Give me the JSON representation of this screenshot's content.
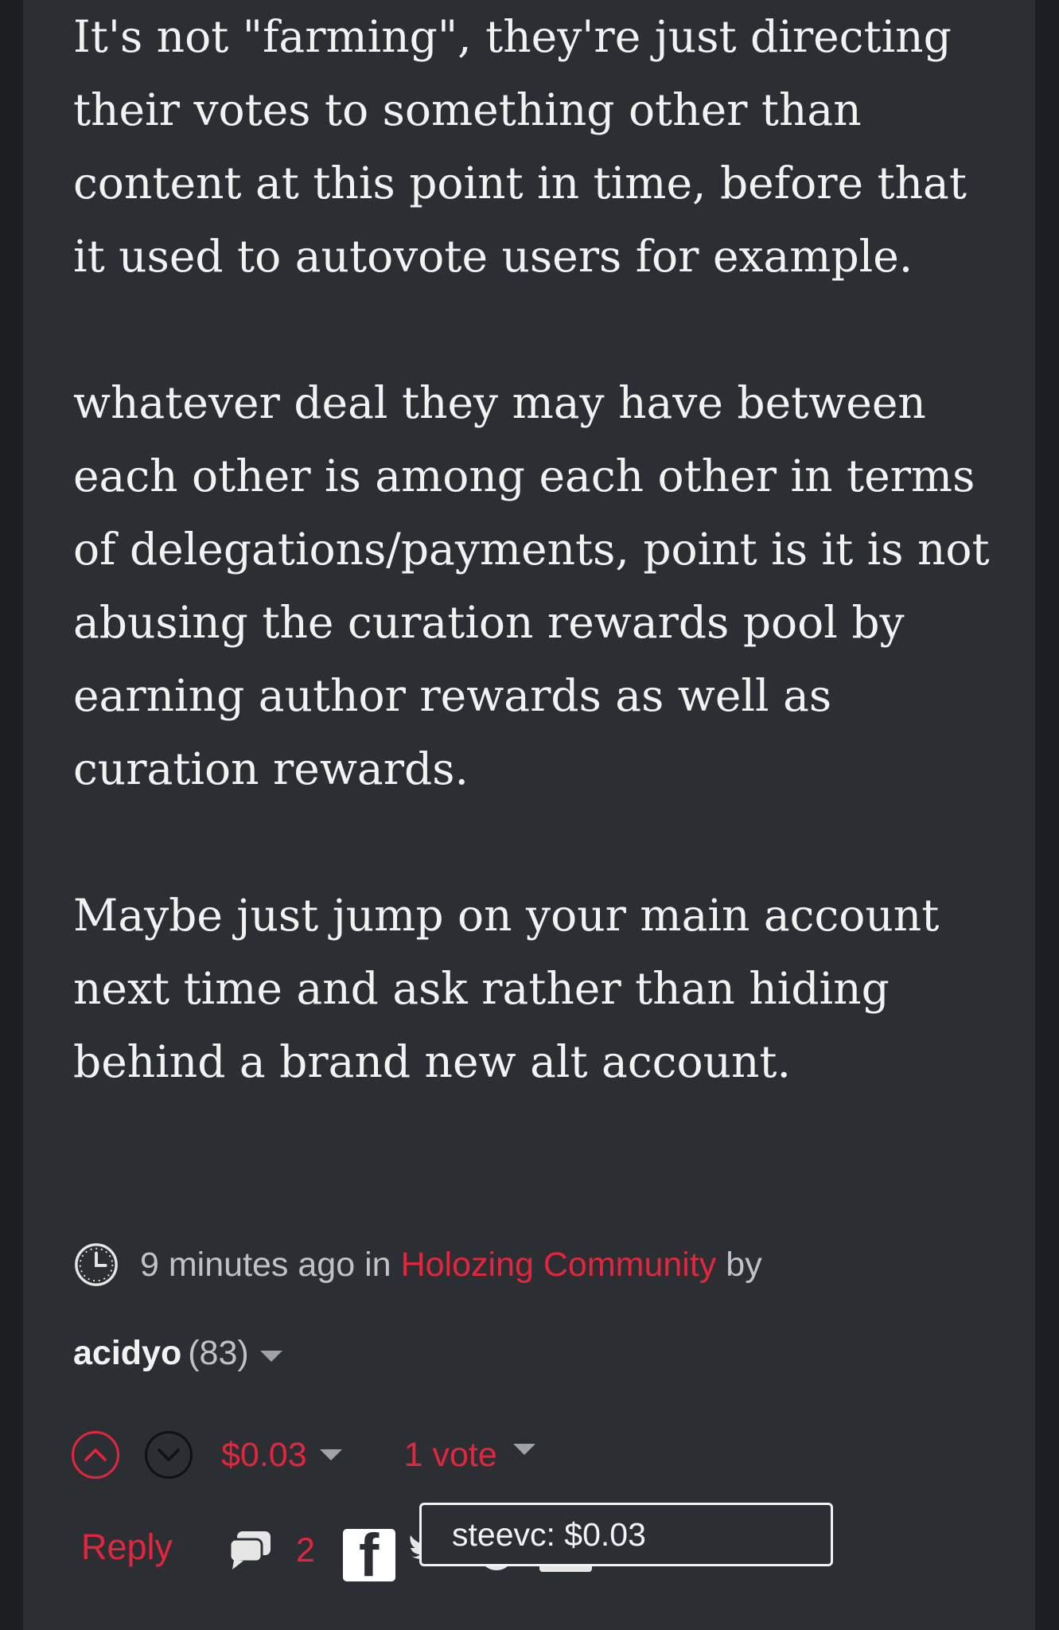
{
  "comment": {
    "paragraphs": [
      "It's not \"farming\", they're just directing\ntheir votes to something other than\ncontent at this point in time, before that\nit used to autovote users for example.",
      "whatever deal they may have between\neach other is among each other in terms\nof delegations/payments, point is it is not\nabusing the curation rewards pool by\nearning author rewards as well as\ncuration rewards.",
      "Maybe just jump on your main account\nnext time and ask rather than hiding\nbehind a brand new alt account."
    ]
  },
  "meta": {
    "time_ago": "9 minutes ago",
    "in_word": "in",
    "community": "Holozing Community",
    "by_word": "by"
  },
  "author": {
    "name": "acidyo",
    "reputation": "(83)"
  },
  "voting": {
    "payout": "$0.03",
    "votes": "1 vote"
  },
  "actions": {
    "reply_label": "Reply",
    "comment_count": "2"
  },
  "tooltip": {
    "text": "steevc: $0.03"
  },
  "colors": {
    "accent": "#e3263d",
    "background": "#2b2f34",
    "text": "#f2f2f2",
    "muted": "#bfc3c8"
  },
  "icons": [
    "clock-icon",
    "chevron-down-icon",
    "upvote-chevron-icon",
    "downvote-chevron-icon",
    "comments-icon",
    "facebook-icon",
    "twitter-icon",
    "reddit-icon",
    "linkedin-icon"
  ]
}
